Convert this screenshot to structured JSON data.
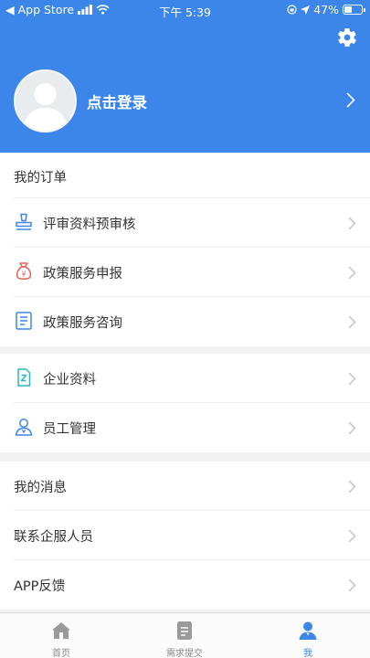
{
  "status_bar": {
    "carrier": "◀ App Store",
    "time": "下午 5:39",
    "battery": "47%",
    "battery_level": 0.47
  },
  "header": {
    "login_text": "点击登录",
    "settings_icon": "gear-icon",
    "background": "#3b86e8"
  },
  "orders": {
    "title": "我的订单",
    "items": [
      {
        "label": "评审资料预审核",
        "icon": "stamp-icon"
      },
      {
        "label": "政策服务申报",
        "icon": "money-bag-icon"
      },
      {
        "label": "政策服务咨询",
        "icon": "document-list-icon"
      }
    ]
  },
  "company": {
    "items": [
      {
        "label": "企业资料",
        "icon": "company-file-icon"
      },
      {
        "label": "员工管理",
        "icon": "employee-icon"
      }
    ]
  },
  "misc": {
    "items": [
      {
        "label": "我的消息"
      },
      {
        "label": "联系企服人员"
      },
      {
        "label": "APP反馈"
      }
    ]
  },
  "tabbar": {
    "tabs": [
      {
        "label": "首页",
        "icon": "home-icon"
      },
      {
        "label": "需求提交",
        "icon": "submit-document-icon"
      },
      {
        "label": "我",
        "icon": "user-icon",
        "active": true
      }
    ],
    "active_color": "#3b86e8"
  }
}
